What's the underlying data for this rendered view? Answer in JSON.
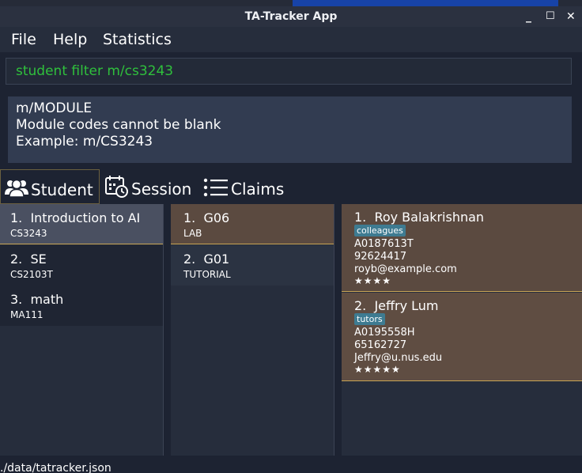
{
  "window": {
    "title": "TA-Tracker App",
    "controls": {
      "minimize": "_",
      "maximize": "☐",
      "close": "✕"
    }
  },
  "menu": {
    "file": "File",
    "help": "Help",
    "statistics": "Statistics"
  },
  "command": {
    "value": "student filter m/cs3243",
    "color": "#2fc03c"
  },
  "result": {
    "line1": "m/MODULE",
    "line2": "Module codes cannot be blank",
    "line3": "Example: m/CS3243"
  },
  "tabs": [
    {
      "label": "Student",
      "icon": "users-icon",
      "active": true
    },
    {
      "label": "Session",
      "icon": "calendar-clock-icon",
      "active": false
    },
    {
      "label": "Claims",
      "icon": "list-icon",
      "active": false
    }
  ],
  "modules": [
    {
      "index": "1.",
      "name": "Introduction to AI",
      "code": "CS3243"
    },
    {
      "index": "2.",
      "name": "SE",
      "code": "CS2103T"
    },
    {
      "index": "3.",
      "name": "math",
      "code": "MA111"
    }
  ],
  "groups": [
    {
      "index": "1.",
      "name": "G06",
      "type": "LAB"
    },
    {
      "index": "2.",
      "name": "G01",
      "type": "TUTORIAL"
    }
  ],
  "students": [
    {
      "index": "1.",
      "name": "Roy Balakrishnan",
      "tag": "colleagues",
      "matric": "A0187613T",
      "phone": "92624417",
      "email": "royb@example.com",
      "rating": "★★★★"
    },
    {
      "index": "2.",
      "name": "Jeffry Lum",
      "tag": "tutors",
      "matric": "A0195558H",
      "phone": "65162727",
      "email": "Jeffry@u.nus.edu",
      "rating": "★★★★★"
    }
  ],
  "status": {
    "path": "./data/tatracker.json"
  },
  "colors": {
    "accent": "#c8a554",
    "tag": "#3e7b91",
    "selected_card": "#5b4a40"
  }
}
